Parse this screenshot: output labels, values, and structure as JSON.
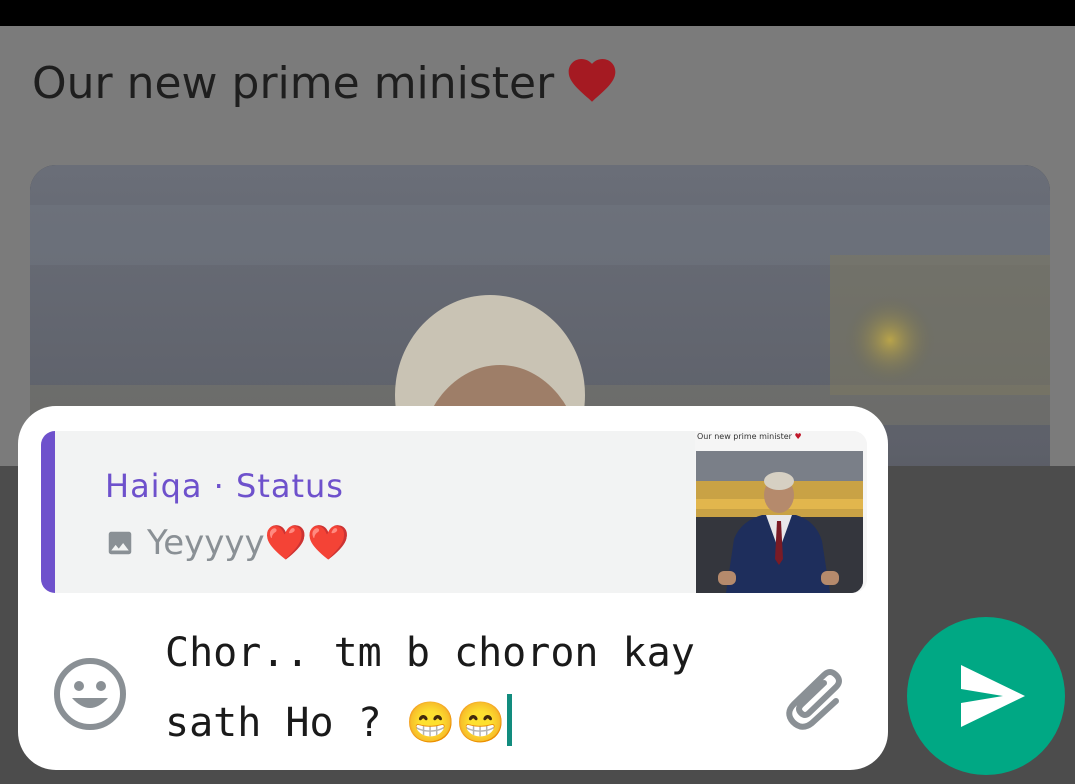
{
  "status_view": {
    "caption": "Our new prime minister",
    "heart_icon": "red-heart-icon"
  },
  "reply_quote": {
    "author": "Haiqa · Status",
    "media_icon": "photo-icon",
    "text": "Yeyyyy❤️❤️",
    "thumbnail_caption": "Our new prime minister",
    "accent_color": "#6e51cc"
  },
  "composer": {
    "emoji_icon": "emoji-icon",
    "message": "Chor.. tm b choron kay\nsath Ho ? 😁😁",
    "attach_icon": "paperclip-icon",
    "send_icon": "send-icon",
    "send_color": "#00a884"
  }
}
